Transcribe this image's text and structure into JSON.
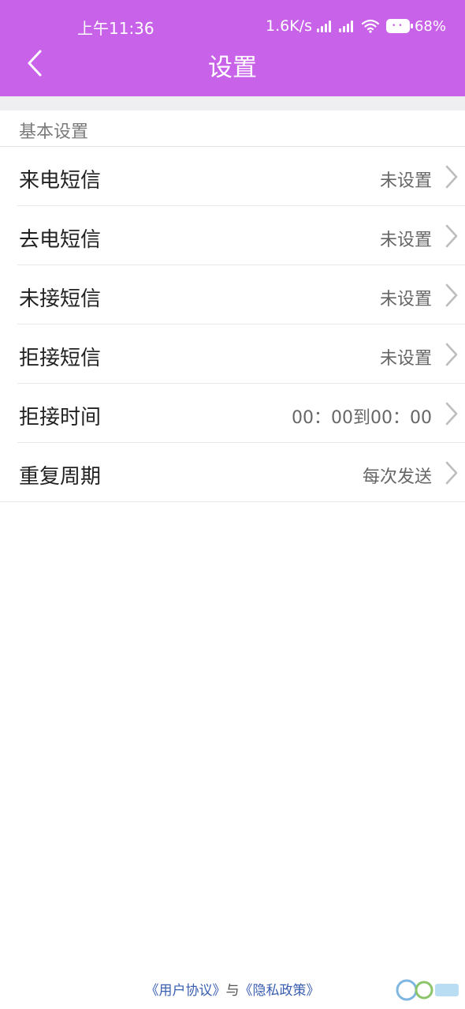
{
  "status_bar": {
    "time": "上午11:36",
    "net_speed": "1.6K/s",
    "battery_pct": "68%"
  },
  "header": {
    "title": "设置",
    "bg_color": "#c862e8"
  },
  "section": {
    "label": "基本设置"
  },
  "rows": [
    {
      "label": "来电短信",
      "value": "未设置"
    },
    {
      "label": "去电短信",
      "value": "未设置"
    },
    {
      "label": "未接短信",
      "value": "未设置"
    },
    {
      "label": "拒接短信",
      "value": "未设置"
    },
    {
      "label": "拒接时间",
      "value": "00：00到00：00"
    },
    {
      "label": "重复周期",
      "value": "每次发送"
    }
  ],
  "footer": {
    "user_agreement": "《用户协议》",
    "joiner": "与",
    "privacy_policy": "《隐私政策》"
  },
  "icons": {
    "back": "chevron-left-icon",
    "row_arrow": "chevron-right-icon",
    "wifi": "wifi-icon",
    "signal": "signal-icon",
    "battery": "battery-icon"
  }
}
